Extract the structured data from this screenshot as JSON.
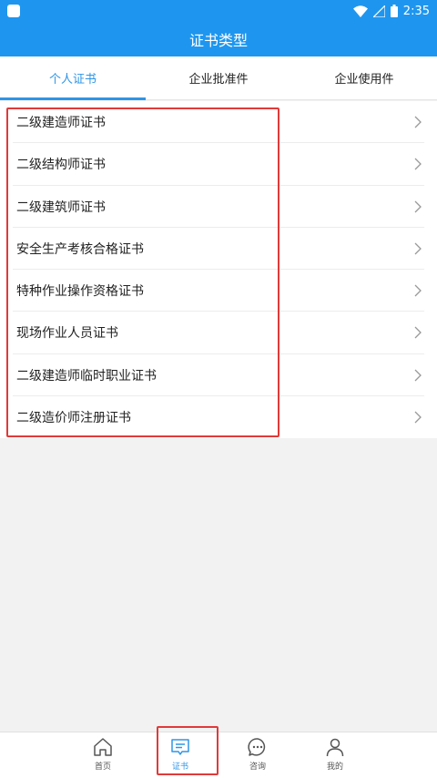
{
  "status_bar": {
    "time": "2:35"
  },
  "header": {
    "title": "证书类型"
  },
  "tabs": [
    {
      "label": "个人证书",
      "active": true
    },
    {
      "label": "企业批准件",
      "active": false
    },
    {
      "label": "企业使用件",
      "active": false
    }
  ],
  "certificates": [
    {
      "label": "二级建造师证书"
    },
    {
      "label": "二级结构师证书"
    },
    {
      "label": "二级建筑师证书"
    },
    {
      "label": "安全生产考核合格证书"
    },
    {
      "label": "特种作业操作资格证书"
    },
    {
      "label": "现场作业人员证书"
    },
    {
      "label": "二级建造师临时职业证书"
    },
    {
      "label": "二级造价师注册证书"
    }
  ],
  "bottom_nav": [
    {
      "label": "首页",
      "icon": "home-icon",
      "active": false
    },
    {
      "label": "证书",
      "icon": "certificate-icon",
      "active": true
    },
    {
      "label": "咨询",
      "icon": "chat-icon",
      "active": false
    },
    {
      "label": "我的",
      "icon": "user-icon",
      "active": false
    }
  ],
  "colors": {
    "primary": "#1e96ef",
    "accent": "#2e95e6",
    "highlight": "#e03a3a"
  }
}
